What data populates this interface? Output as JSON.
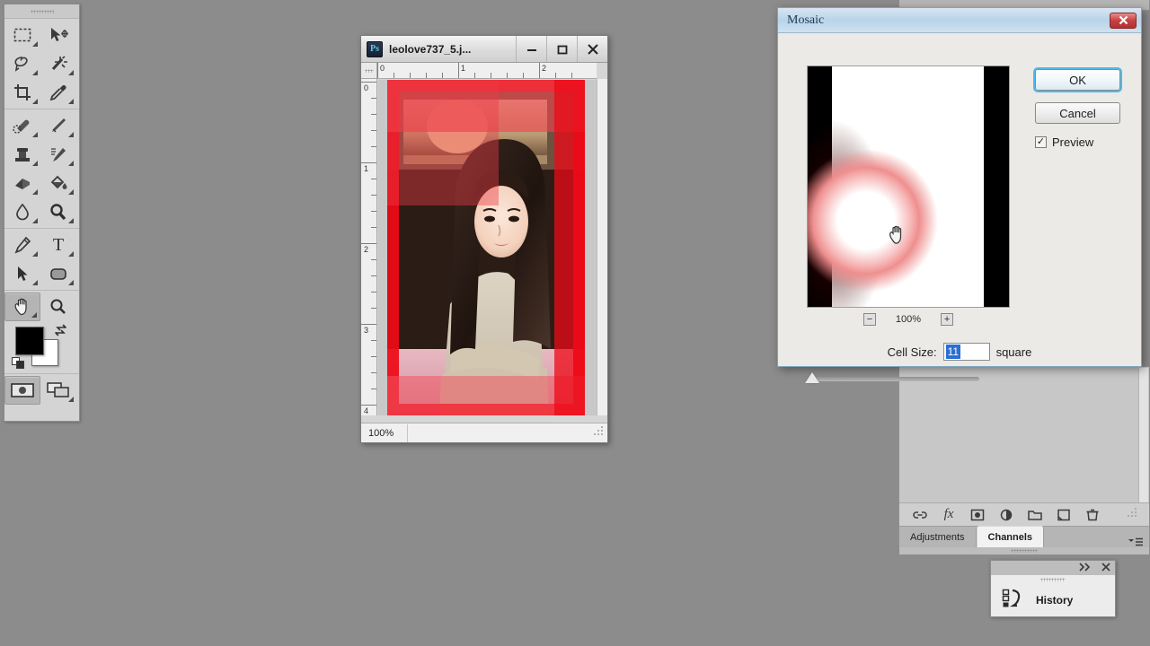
{
  "app": {
    "toolbar": {
      "tools": [
        {
          "name": "rectangular-marquee-tool",
          "selected": false
        },
        {
          "name": "move-tool",
          "selected": false
        },
        {
          "name": "lasso-tool",
          "selected": false
        },
        {
          "name": "magic-wand-tool",
          "selected": false
        },
        {
          "name": "crop-tool",
          "selected": false
        },
        {
          "name": "eyedropper-tool",
          "selected": false
        },
        {
          "name": "healing-brush-tool",
          "selected": false
        },
        {
          "name": "brush-tool",
          "selected": false
        },
        {
          "name": "clone-stamp-tool",
          "selected": false
        },
        {
          "name": "history-brush-tool",
          "selected": false
        },
        {
          "name": "eraser-tool",
          "selected": false
        },
        {
          "name": "paint-bucket-tool",
          "selected": false
        },
        {
          "name": "blur-tool",
          "selected": false
        },
        {
          "name": "dodge-tool",
          "selected": false
        },
        {
          "name": "pen-tool",
          "selected": false
        },
        {
          "name": "type-tool",
          "selected": false,
          "glyph": "T"
        },
        {
          "name": "path-selection-tool",
          "selected": false
        },
        {
          "name": "rounded-rectangle-tool",
          "selected": false
        },
        {
          "name": "hand-tool",
          "selected": true
        },
        {
          "name": "zoom-tool",
          "selected": false
        }
      ],
      "foreground_color": "#000000",
      "background_color": "#ffffff"
    },
    "document_window": {
      "title": "leolove737_5.j...",
      "zoom_status": "100%",
      "ruler_horizontal_labels": [
        "0",
        "1",
        "2"
      ],
      "ruler_vertical_labels": [
        "0",
        "1",
        "2",
        "3",
        "4"
      ],
      "minimize_label": "—",
      "maximize_label": "❑",
      "close_label": "✕"
    },
    "right_panels": {
      "tabs": [
        {
          "label": "Adjustments",
          "active": false
        },
        {
          "label": "Channels",
          "active": true
        }
      ],
      "layer_icons": [
        "link-layers-icon",
        "layer-style-fx-icon",
        "add-layer-mask-icon",
        "new-fill-adjustment-layer-icon",
        "new-group-icon",
        "new-layer-icon",
        "delete-layer-icon"
      ]
    },
    "history_panel": {
      "label": "History",
      "collapse_label": "▸▸",
      "close_label": "✕"
    },
    "mosaic_dialog": {
      "title": "Mosaic",
      "close_label": "✕",
      "ok_label": "OK",
      "cancel_label": "Cancel",
      "preview_label": "Preview",
      "preview_checked": true,
      "preview_check_glyph": "✓",
      "zoom_out_label": "−",
      "zoom_in_label": "+",
      "zoom_level": "100%",
      "cell_size_label": "Cell Size:",
      "cell_size_value": "11",
      "cell_size_unit": "square",
      "accent_color": "#2a6fd4",
      "focus_ring_color": "#4fb9e8"
    }
  }
}
